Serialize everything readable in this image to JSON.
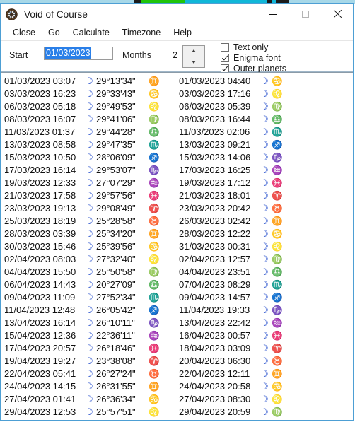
{
  "window": {
    "title": "Void of Course",
    "icon": "astrology-wheel-icon",
    "controls": {
      "minimize_label": "minimize-icon",
      "maximize_label": "maximize-icon",
      "close_label": "close-icon"
    }
  },
  "menu": {
    "items": [
      {
        "label": "Close"
      },
      {
        "label": "Go"
      },
      {
        "label": "Calculate"
      },
      {
        "label": "Timezone"
      },
      {
        "label": "Help"
      }
    ]
  },
  "toolbar": {
    "start_label": "Start",
    "start_value": "01/03/2023",
    "months_label": "Months",
    "months_value": "2",
    "spinner_up": "▲",
    "spinner_down": "▼",
    "checkboxes": [
      {
        "label": "Text only",
        "checked": false
      },
      {
        "label": "Enigma font",
        "checked": true
      },
      {
        "label": "Outer planets",
        "checked": true
      }
    ]
  },
  "glyphs": {
    "moon": "☽",
    "aries": "♈",
    "taurus": "♉",
    "gemini": "♊",
    "cancer": "♋",
    "leo": "♌",
    "virgo": "♍",
    "libra": "♎",
    "scorpio": "♏",
    "sagittarius": "♐",
    "capricorn": "♑",
    "aquarius": "♒",
    "pisces": "♓"
  },
  "results": {
    "start_column": [
      {
        "datetime": "01/03/2023 03:07",
        "body": "☽",
        "degree": "29°13'34\"",
        "sign": "♊",
        "sign_name": "gemini"
      },
      {
        "datetime": "03/03/2023 16:23",
        "body": "☽",
        "degree": "29°33'43\"",
        "sign": "♋",
        "sign_name": "cancer"
      },
      {
        "datetime": "06/03/2023 05:18",
        "body": "☽",
        "degree": "29°49'53\"",
        "sign": "♌",
        "sign_name": "leo"
      },
      {
        "datetime": "08/03/2023 16:07",
        "body": "☽",
        "degree": "29°41'06\"",
        "sign": "♍",
        "sign_name": "virgo"
      },
      {
        "datetime": "11/03/2023 01:37",
        "body": "☽",
        "degree": "29°44'28\"",
        "sign": "♎",
        "sign_name": "libra"
      },
      {
        "datetime": "13/03/2023 08:58",
        "body": "☽",
        "degree": "29°47'35\"",
        "sign": "♏",
        "sign_name": "scorpio"
      },
      {
        "datetime": "15/03/2023 10:50",
        "body": "☽",
        "degree": "28°06'09\"",
        "sign": "♐",
        "sign_name": "sagittarius"
      },
      {
        "datetime": "17/03/2023 16:14",
        "body": "☽",
        "degree": "29°53'07\"",
        "sign": "♑",
        "sign_name": "capricorn"
      },
      {
        "datetime": "19/03/2023 12:33",
        "body": "☽",
        "degree": "27°07'29\"",
        "sign": "♒",
        "sign_name": "aquarius"
      },
      {
        "datetime": "21/03/2023 17:58",
        "body": "☽",
        "degree": "29°57'56\"",
        "sign": "♓",
        "sign_name": "pisces"
      },
      {
        "datetime": "23/03/2023 19:13",
        "body": "☽",
        "degree": "29°08'49\"",
        "sign": "♈",
        "sign_name": "aries"
      },
      {
        "datetime": "25/03/2023 18:19",
        "body": "☽",
        "degree": "25°28'58\"",
        "sign": "♉",
        "sign_name": "taurus"
      },
      {
        "datetime": "28/03/2023 03:39",
        "body": "☽",
        "degree": "25°34'20\"",
        "sign": "♊",
        "sign_name": "gemini"
      },
      {
        "datetime": "30/03/2023 15:46",
        "body": "☽",
        "degree": "25°39'56\"",
        "sign": "♋",
        "sign_name": "cancer"
      },
      {
        "datetime": "02/04/2023 08:03",
        "body": "☽",
        "degree": "27°32'40\"",
        "sign": "♌",
        "sign_name": "leo"
      },
      {
        "datetime": "04/04/2023 15:50",
        "body": "☽",
        "degree": "25°50'58\"",
        "sign": "♍",
        "sign_name": "virgo"
      },
      {
        "datetime": "06/04/2023 14:43",
        "body": "☽",
        "degree": "20°27'09\"",
        "sign": "♎",
        "sign_name": "libra"
      },
      {
        "datetime": "09/04/2023 11:09",
        "body": "☽",
        "degree": "27°52'34\"",
        "sign": "♏",
        "sign_name": "scorpio"
      },
      {
        "datetime": "11/04/2023 12:48",
        "body": "☽",
        "degree": "26°05'42\"",
        "sign": "♐",
        "sign_name": "sagittarius"
      },
      {
        "datetime": "13/04/2023 16:14",
        "body": "☽",
        "degree": "26°10'11\"",
        "sign": "♑",
        "sign_name": "capricorn"
      },
      {
        "datetime": "15/04/2023 12:36",
        "body": "☽",
        "degree": "22°36'11\"",
        "sign": "♒",
        "sign_name": "aquarius"
      },
      {
        "datetime": "17/04/2023 20:57",
        "body": "☽",
        "degree": "26°18'46\"",
        "sign": "♓",
        "sign_name": "pisces"
      },
      {
        "datetime": "19/04/2023 19:27",
        "body": "☽",
        "degree": "23°38'08\"",
        "sign": "♈",
        "sign_name": "aries"
      },
      {
        "datetime": "22/04/2023 05:41",
        "body": "☽",
        "degree": "26°27'24\"",
        "sign": "♉",
        "sign_name": "taurus"
      },
      {
        "datetime": "24/04/2023 14:15",
        "body": "☽",
        "degree": "26°31'55\"",
        "sign": "♊",
        "sign_name": "gemini"
      },
      {
        "datetime": "27/04/2023 01:41",
        "body": "☽",
        "degree": "26°36'34\"",
        "sign": "♋",
        "sign_name": "cancer"
      },
      {
        "datetime": "29/04/2023 12:53",
        "body": "☽",
        "degree": "25°57'51\"",
        "sign": "♌",
        "sign_name": "leo"
      }
    ],
    "end_column": [
      {
        "datetime": "01/03/2023 04:40",
        "body": "☽",
        "sign": "♋",
        "sign_name": "cancer"
      },
      {
        "datetime": "03/03/2023 17:16",
        "body": "☽",
        "sign": "♌",
        "sign_name": "leo"
      },
      {
        "datetime": "06/03/2023 05:39",
        "body": "☽",
        "sign": "♍",
        "sign_name": "virgo"
      },
      {
        "datetime": "08/03/2023 16:44",
        "body": "☽",
        "sign": "♎",
        "sign_name": "libra"
      },
      {
        "datetime": "11/03/2023 02:06",
        "body": "☽",
        "sign": "♏",
        "sign_name": "scorpio"
      },
      {
        "datetime": "13/03/2023 09:21",
        "body": "☽",
        "sign": "♐",
        "sign_name": "sagittarius"
      },
      {
        "datetime": "15/03/2023 14:06",
        "body": "☽",
        "sign": "♑",
        "sign_name": "capricorn"
      },
      {
        "datetime": "17/03/2023 16:25",
        "body": "☽",
        "sign": "♒",
        "sign_name": "aquarius"
      },
      {
        "datetime": "19/03/2023 17:12",
        "body": "☽",
        "sign": "♓",
        "sign_name": "pisces"
      },
      {
        "datetime": "21/03/2023 18:01",
        "body": "☽",
        "sign": "♈",
        "sign_name": "aries"
      },
      {
        "datetime": "23/03/2023 20:42",
        "body": "☽",
        "sign": "♉",
        "sign_name": "taurus"
      },
      {
        "datetime": "26/03/2023 02:42",
        "body": "☽",
        "sign": "♊",
        "sign_name": "gemini"
      },
      {
        "datetime": "28/03/2023 12:22",
        "body": "☽",
        "sign": "♋",
        "sign_name": "cancer"
      },
      {
        "datetime": "31/03/2023 00:31",
        "body": "☽",
        "sign": "♌",
        "sign_name": "leo"
      },
      {
        "datetime": "02/04/2023 12:57",
        "body": "☽",
        "sign": "♍",
        "sign_name": "virgo"
      },
      {
        "datetime": "04/04/2023 23:51",
        "body": "☽",
        "sign": "♎",
        "sign_name": "libra"
      },
      {
        "datetime": "07/04/2023 08:29",
        "body": "☽",
        "sign": "♏",
        "sign_name": "scorpio"
      },
      {
        "datetime": "09/04/2023 14:57",
        "body": "☽",
        "sign": "♐",
        "sign_name": "sagittarius"
      },
      {
        "datetime": "11/04/2023 19:33",
        "body": "☽",
        "sign": "♑",
        "sign_name": "capricorn"
      },
      {
        "datetime": "13/04/2023 22:42",
        "body": "☽",
        "sign": "♒",
        "sign_name": "aquarius"
      },
      {
        "datetime": "16/04/2023 00:57",
        "body": "☽",
        "sign": "♓",
        "sign_name": "pisces"
      },
      {
        "datetime": "18/04/2023 03:09",
        "body": "☽",
        "sign": "♈",
        "sign_name": "aries"
      },
      {
        "datetime": "20/04/2023 06:30",
        "body": "☽",
        "sign": "♉",
        "sign_name": "taurus"
      },
      {
        "datetime": "22/04/2023 12:11",
        "body": "☽",
        "sign": "♊",
        "sign_name": "gemini"
      },
      {
        "datetime": "24/04/2023 20:58",
        "body": "☽",
        "sign": "♋",
        "sign_name": "cancer"
      },
      {
        "datetime": "27/04/2023 08:30",
        "body": "☽",
        "sign": "♌",
        "sign_name": "leo"
      },
      {
        "datetime": "29/04/2023 20:59",
        "body": "☽",
        "sign": "♍",
        "sign_name": "virgo"
      }
    ]
  },
  "colors": {
    "window_border": "#4d9fd4",
    "selection": "#2a7fe8",
    "moon_glyph": "#1340c8",
    "fire_sign": "#e01b1b",
    "earth_sign": "#e24a16",
    "air_sign": "#4d7fd6",
    "water_sign": "#19a019"
  }
}
